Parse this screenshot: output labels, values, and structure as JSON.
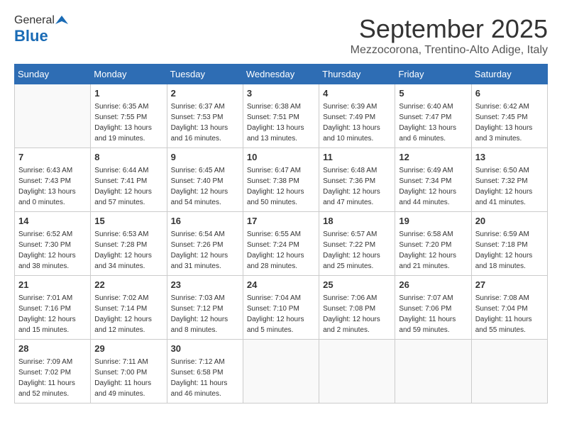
{
  "logo": {
    "general": "General",
    "blue": "Blue"
  },
  "title": "September 2025",
  "location": "Mezzocorona, Trentino-Alto Adige, Italy",
  "days_of_week": [
    "Sunday",
    "Monday",
    "Tuesday",
    "Wednesday",
    "Thursday",
    "Friday",
    "Saturday"
  ],
  "weeks": [
    [
      {
        "day": "",
        "info": ""
      },
      {
        "day": "1",
        "info": "Sunrise: 6:35 AM\nSunset: 7:55 PM\nDaylight: 13 hours\nand 19 minutes."
      },
      {
        "day": "2",
        "info": "Sunrise: 6:37 AM\nSunset: 7:53 PM\nDaylight: 13 hours\nand 16 minutes."
      },
      {
        "day": "3",
        "info": "Sunrise: 6:38 AM\nSunset: 7:51 PM\nDaylight: 13 hours\nand 13 minutes."
      },
      {
        "day": "4",
        "info": "Sunrise: 6:39 AM\nSunset: 7:49 PM\nDaylight: 13 hours\nand 10 minutes."
      },
      {
        "day": "5",
        "info": "Sunrise: 6:40 AM\nSunset: 7:47 PM\nDaylight: 13 hours\nand 6 minutes."
      },
      {
        "day": "6",
        "info": "Sunrise: 6:42 AM\nSunset: 7:45 PM\nDaylight: 13 hours\nand 3 minutes."
      }
    ],
    [
      {
        "day": "7",
        "info": "Sunrise: 6:43 AM\nSunset: 7:43 PM\nDaylight: 13 hours\nand 0 minutes."
      },
      {
        "day": "8",
        "info": "Sunrise: 6:44 AM\nSunset: 7:41 PM\nDaylight: 12 hours\nand 57 minutes."
      },
      {
        "day": "9",
        "info": "Sunrise: 6:45 AM\nSunset: 7:40 PM\nDaylight: 12 hours\nand 54 minutes."
      },
      {
        "day": "10",
        "info": "Sunrise: 6:47 AM\nSunset: 7:38 PM\nDaylight: 12 hours\nand 50 minutes."
      },
      {
        "day": "11",
        "info": "Sunrise: 6:48 AM\nSunset: 7:36 PM\nDaylight: 12 hours\nand 47 minutes."
      },
      {
        "day": "12",
        "info": "Sunrise: 6:49 AM\nSunset: 7:34 PM\nDaylight: 12 hours\nand 44 minutes."
      },
      {
        "day": "13",
        "info": "Sunrise: 6:50 AM\nSunset: 7:32 PM\nDaylight: 12 hours\nand 41 minutes."
      }
    ],
    [
      {
        "day": "14",
        "info": "Sunrise: 6:52 AM\nSunset: 7:30 PM\nDaylight: 12 hours\nand 38 minutes."
      },
      {
        "day": "15",
        "info": "Sunrise: 6:53 AM\nSunset: 7:28 PM\nDaylight: 12 hours\nand 34 minutes."
      },
      {
        "day": "16",
        "info": "Sunrise: 6:54 AM\nSunset: 7:26 PM\nDaylight: 12 hours\nand 31 minutes."
      },
      {
        "day": "17",
        "info": "Sunrise: 6:55 AM\nSunset: 7:24 PM\nDaylight: 12 hours\nand 28 minutes."
      },
      {
        "day": "18",
        "info": "Sunrise: 6:57 AM\nSunset: 7:22 PM\nDaylight: 12 hours\nand 25 minutes."
      },
      {
        "day": "19",
        "info": "Sunrise: 6:58 AM\nSunset: 7:20 PM\nDaylight: 12 hours\nand 21 minutes."
      },
      {
        "day": "20",
        "info": "Sunrise: 6:59 AM\nSunset: 7:18 PM\nDaylight: 12 hours\nand 18 minutes."
      }
    ],
    [
      {
        "day": "21",
        "info": "Sunrise: 7:01 AM\nSunset: 7:16 PM\nDaylight: 12 hours\nand 15 minutes."
      },
      {
        "day": "22",
        "info": "Sunrise: 7:02 AM\nSunset: 7:14 PM\nDaylight: 12 hours\nand 12 minutes."
      },
      {
        "day": "23",
        "info": "Sunrise: 7:03 AM\nSunset: 7:12 PM\nDaylight: 12 hours\nand 8 minutes."
      },
      {
        "day": "24",
        "info": "Sunrise: 7:04 AM\nSunset: 7:10 PM\nDaylight: 12 hours\nand 5 minutes."
      },
      {
        "day": "25",
        "info": "Sunrise: 7:06 AM\nSunset: 7:08 PM\nDaylight: 12 hours\nand 2 minutes."
      },
      {
        "day": "26",
        "info": "Sunrise: 7:07 AM\nSunset: 7:06 PM\nDaylight: 11 hours\nand 59 minutes."
      },
      {
        "day": "27",
        "info": "Sunrise: 7:08 AM\nSunset: 7:04 PM\nDaylight: 11 hours\nand 55 minutes."
      }
    ],
    [
      {
        "day": "28",
        "info": "Sunrise: 7:09 AM\nSunset: 7:02 PM\nDaylight: 11 hours\nand 52 minutes."
      },
      {
        "day": "29",
        "info": "Sunrise: 7:11 AM\nSunset: 7:00 PM\nDaylight: 11 hours\nand 49 minutes."
      },
      {
        "day": "30",
        "info": "Sunrise: 7:12 AM\nSunset: 6:58 PM\nDaylight: 11 hours\nand 46 minutes."
      },
      {
        "day": "",
        "info": ""
      },
      {
        "day": "",
        "info": ""
      },
      {
        "day": "",
        "info": ""
      },
      {
        "day": "",
        "info": ""
      }
    ]
  ]
}
